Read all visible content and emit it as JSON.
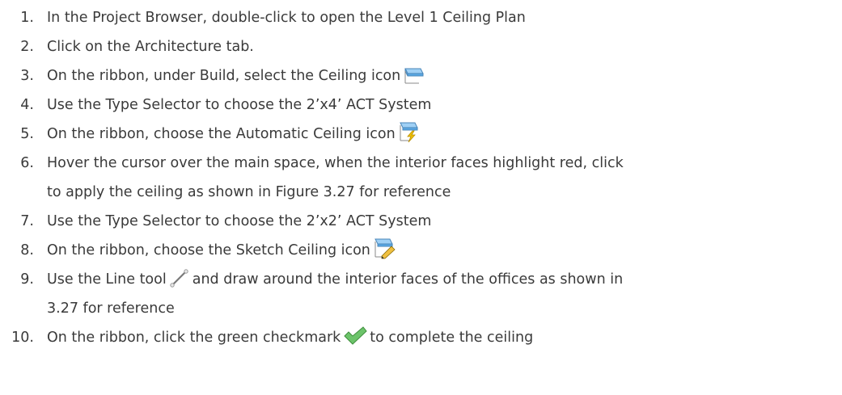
{
  "steps": [
    {
      "num": "1.",
      "text": "In the Project Browser, double-click to open the Level 1 Ceiling Plan"
    },
    {
      "num": "2.",
      "text": "Click on the Architecture tab."
    },
    {
      "num": "3.",
      "text": "On the ribbon, under Build, select the Ceiling icon",
      "icon": "ceiling-icon"
    },
    {
      "num": "4.",
      "text": "Use the Type Selector to choose the 2’x4’ ACT System"
    },
    {
      "num": "5.",
      "text": "On the ribbon, choose the Automatic Ceiling icon",
      "icon": "automatic-ceiling-icon"
    },
    {
      "num": "6.",
      "text": "Hover the cursor over the main space, when the interior faces highlight red, click",
      "text_line2": "to apply the ceiling as shown in Figure 3.27 for reference"
    },
    {
      "num": "7.",
      "text": "Use the Type Selector to choose the 2’x2’ ACT System"
    },
    {
      "num": "8.",
      "text": "On the ribbon, choose the Sketch Ceiling icon",
      "icon": "sketch-ceiling-icon"
    },
    {
      "num": "9.",
      "text_before": "Use the Line tool",
      "icon": "line-tool-icon",
      "text_after": "and draw around the interior faces of the offices as shown in",
      "text_line2": "3.27 for reference"
    },
    {
      "num": "10.",
      "text_before": "On the ribbon, click the green checkmark",
      "icon": "green-checkmark-icon",
      "text_after": "to complete the ceiling"
    }
  ],
  "colors": {
    "text": "#3a3a3a",
    "ceiling_blue": "#5aa9e6",
    "check_green": "#5cb85c",
    "bolt_yellow": "#f2c200"
  }
}
